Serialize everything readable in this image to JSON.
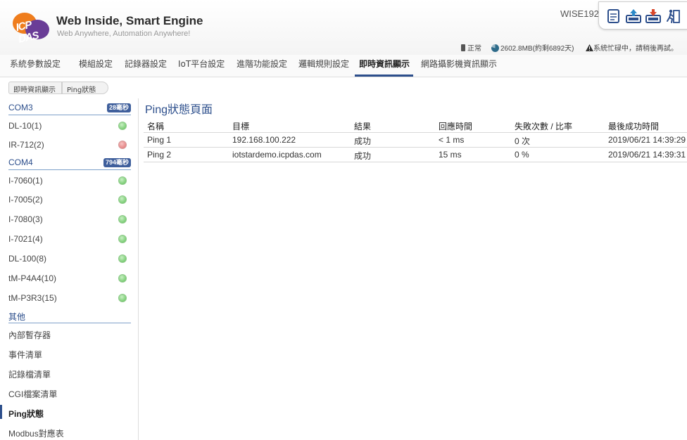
{
  "header": {
    "logo_text": "ICP DAS",
    "title": "Web Inside, Smart Engine",
    "subtitle": "Web Anywhere, Automation Anywhere!",
    "device_name": "WISE192",
    "toolbar": [
      "document-icon",
      "upload-icon",
      "download-icon",
      "logout-icon"
    ]
  },
  "status": {
    "normal": "正常",
    "disk": "2602.8MB(約剩6892天)",
    "warning": "系統忙碌中，請稍後再試。"
  },
  "nav": {
    "items": [
      "系統參數設定",
      "模組設定",
      "記錄器設定",
      "IoT平台設定",
      "進階功能設定",
      "邏輯規則設定",
      "即時資訊顯示",
      "網路攝影機資訊顯示"
    ],
    "active_index": 6
  },
  "breadcrumb": [
    "即時資訊顯示",
    "Ping狀態"
  ],
  "sidebar": {
    "com3": {
      "label": "COM3",
      "badge": "28毫秒"
    },
    "com3_items": [
      {
        "label": "DL-10(1)",
        "status": "ok"
      },
      {
        "label": "IR-712(2)",
        "status": "bad"
      }
    ],
    "com4": {
      "label": "COM4",
      "badge": "794毫秒"
    },
    "com4_items": [
      {
        "label": "I-7060(1)",
        "status": "ok"
      },
      {
        "label": "I-7005(2)",
        "status": "ok"
      },
      {
        "label": "I-7080(3)",
        "status": "ok"
      },
      {
        "label": "I-7021(4)",
        "status": "ok"
      },
      {
        "label": "DL-100(8)",
        "status": "ok"
      },
      {
        "label": "tM-P4A4(10)",
        "status": "ok"
      },
      {
        "label": "tM-P3R3(15)",
        "status": "ok"
      }
    ],
    "other": {
      "label": "其他"
    },
    "other_items": [
      "內部暫存器",
      "事件清單",
      "記錄檔清單",
      "CGI檔案清單",
      "Ping狀態",
      "Modbus對應表"
    ],
    "selected": "Ping狀態"
  },
  "main": {
    "title": "Ping狀態頁面",
    "columns": [
      "名稱",
      "目標",
      "結果",
      "回應時間",
      "失敗次數 / 比率",
      "最後成功時間"
    ],
    "rows": [
      [
        "Ping 1",
        "192.168.100.222",
        "成功",
        "< 1 ms",
        "0 次",
        "2019/06/21 14:39:29"
      ],
      [
        "Ping 2",
        "iotstardemo.icpdas.com",
        "成功",
        "15 ms",
        "0 %",
        "2019/06/21 14:39:31"
      ]
    ]
  },
  "colors": {
    "accent": "#2d4f8c",
    "status_ok": "#5cbf55",
    "status_bad": "#e06b6b",
    "badge": "#3f5f9c"
  }
}
